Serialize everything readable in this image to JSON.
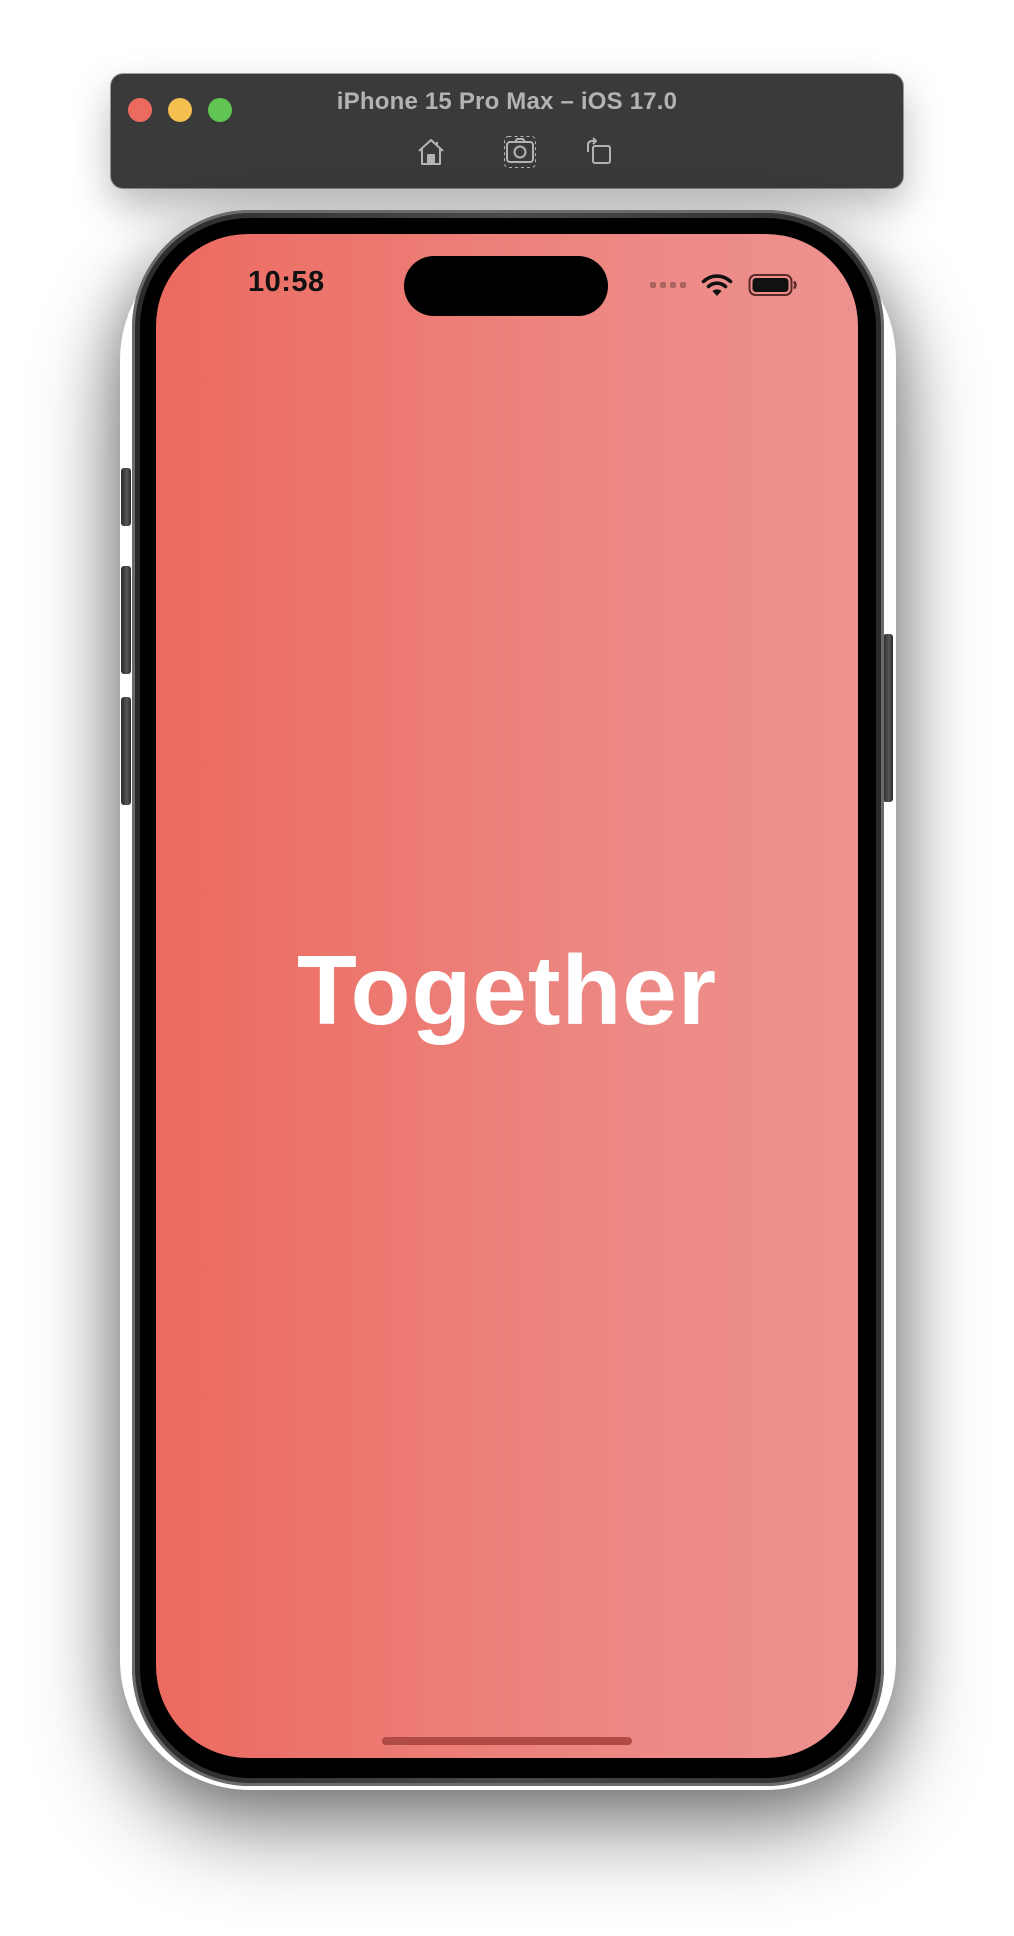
{
  "window": {
    "title": "iPhone 15 Pro Max – iOS 17.0",
    "traffic_lights": {
      "close": "#ed6a5e",
      "minimize": "#f4bf4f",
      "zoom": "#61c554"
    },
    "toolbar": [
      "home-icon",
      "screenshot-icon",
      "rotate-icon"
    ]
  },
  "status_bar": {
    "time": "10:58",
    "icons": [
      "signal-icon",
      "wifi-icon",
      "battery-icon"
    ]
  },
  "screen": {
    "title": "Together",
    "background_gradient": [
      "#ec6a60",
      "#ed918f"
    ],
    "text_color": "#ffffff"
  }
}
